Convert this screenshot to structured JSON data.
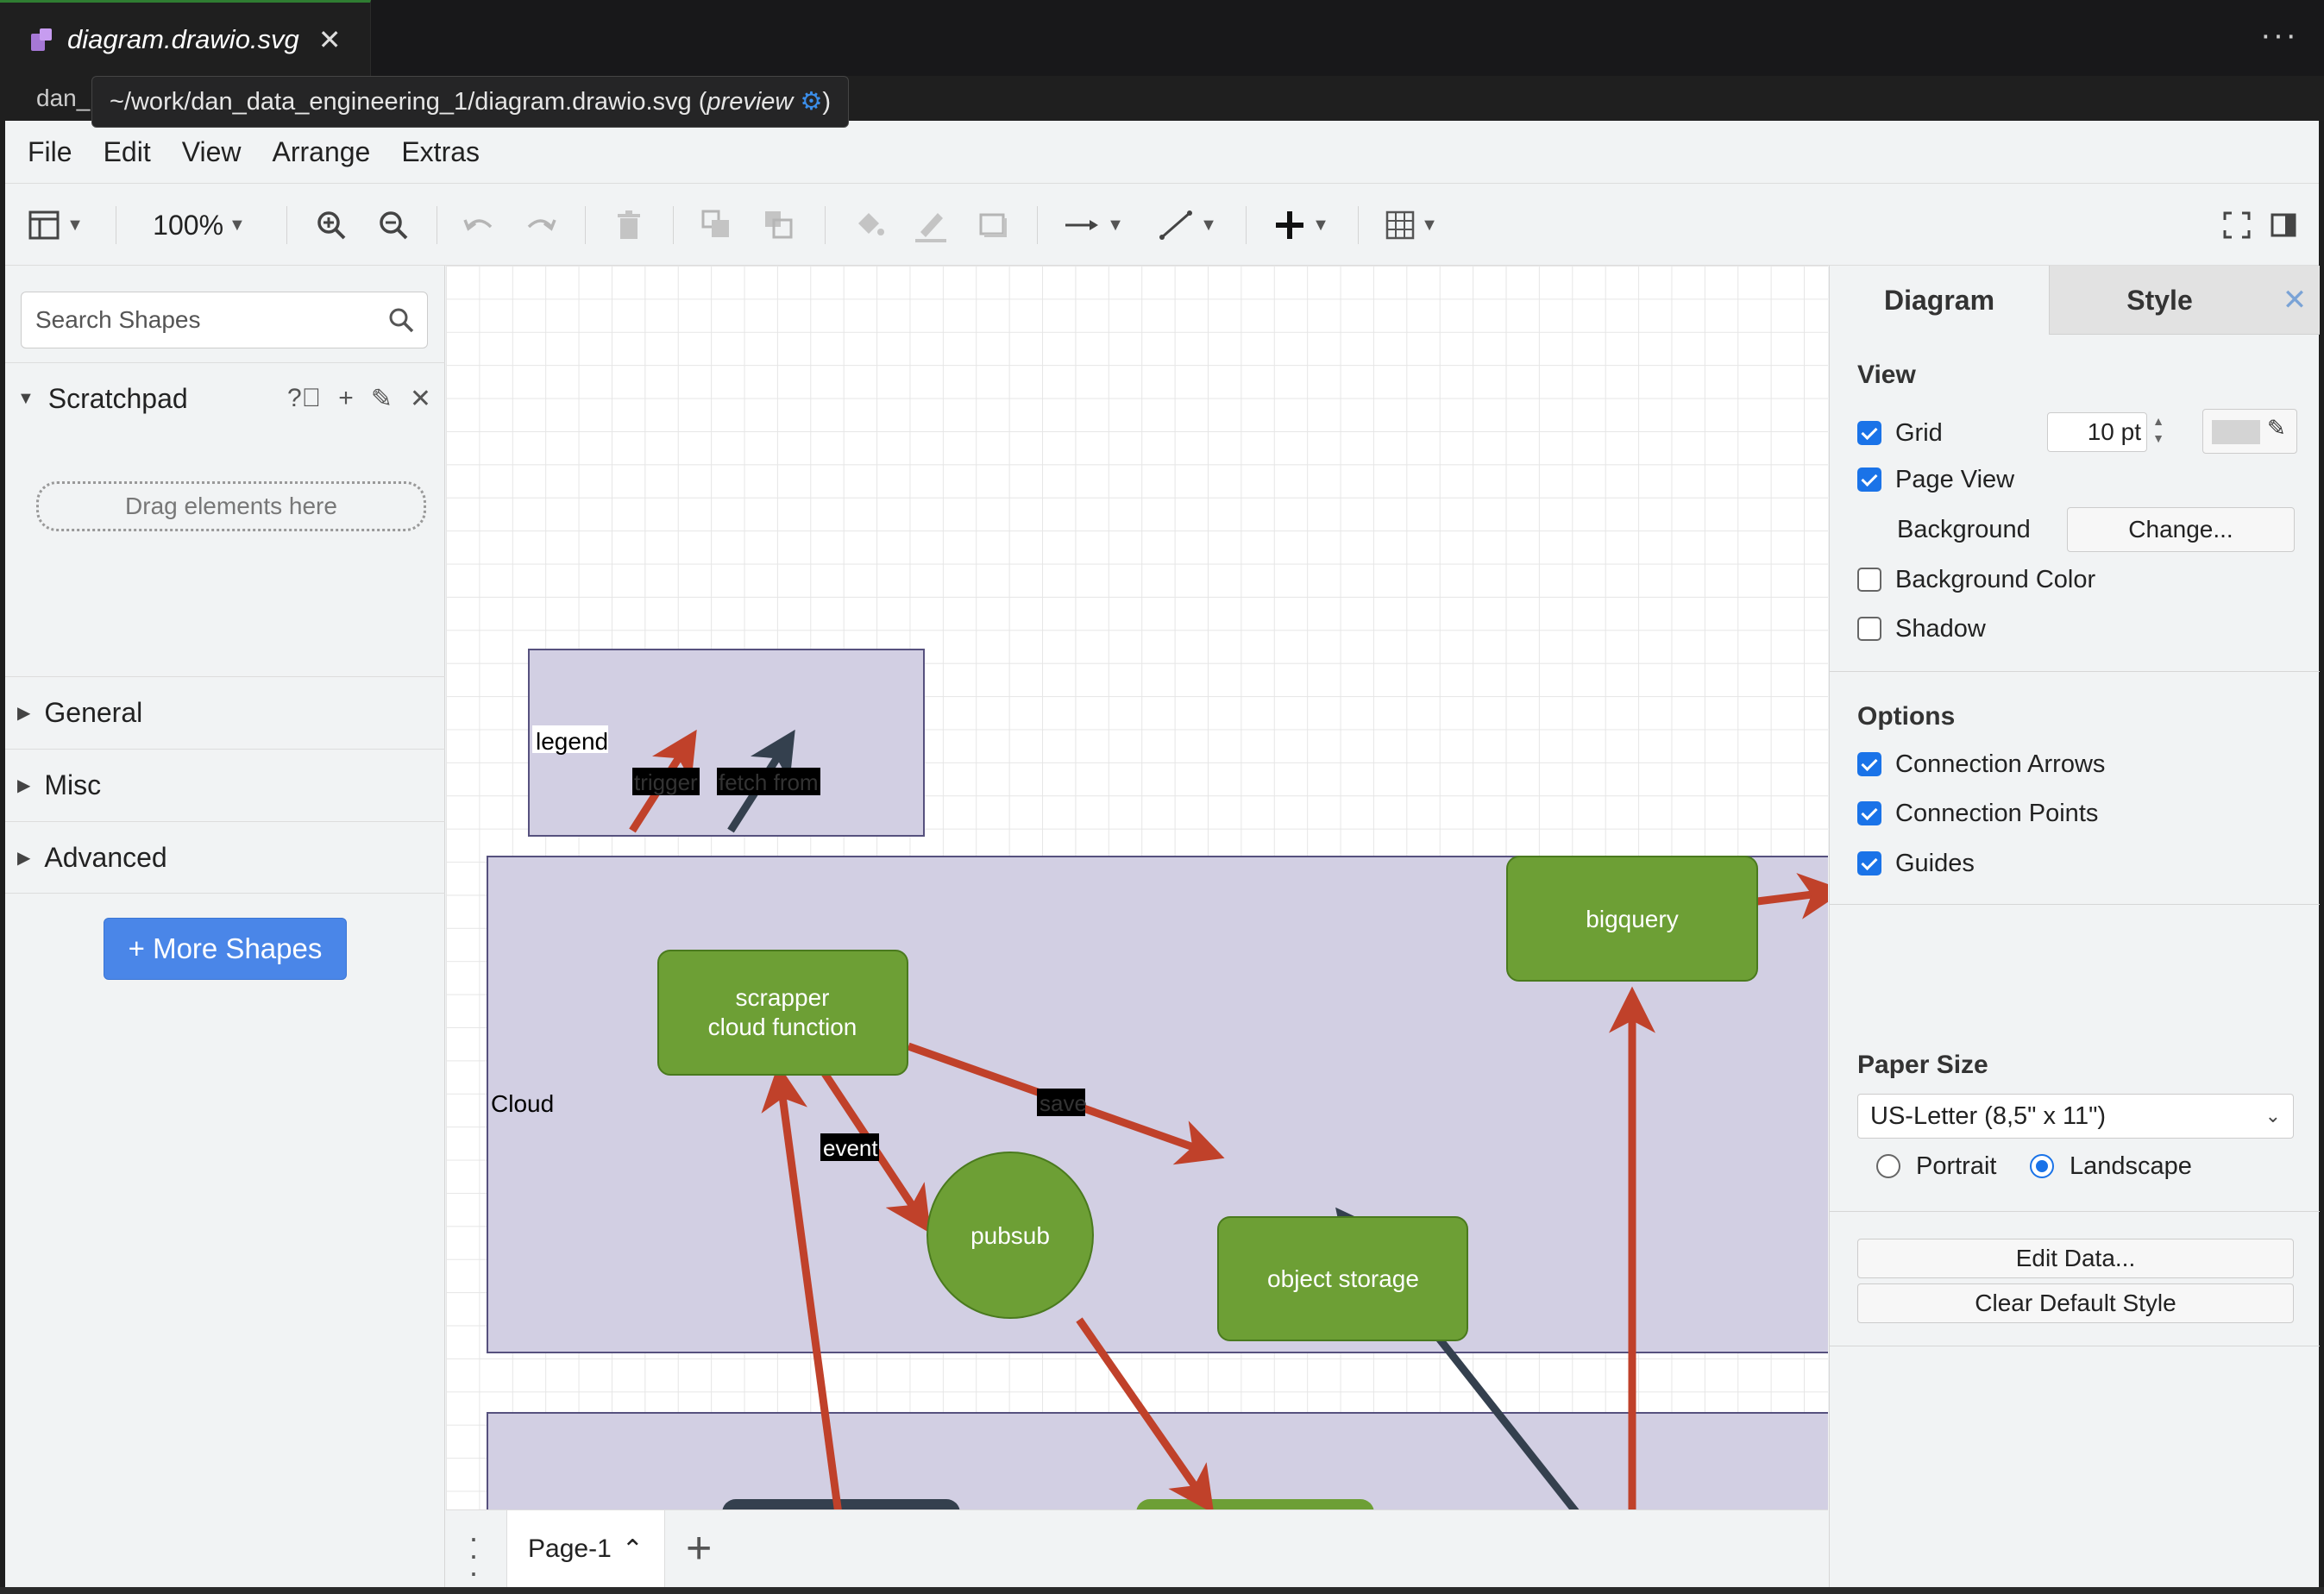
{
  "window": {
    "tab_title": "diagram.drawio.svg",
    "tab_close": "✕",
    "more_actions": "···",
    "breadcrumb_prefix": "dan_",
    "tooltip_path": "~/work/dan_data_engineering_1/diagram.drawio.svg (",
    "tooltip_preview": "preview",
    "tooltip_end": ")"
  },
  "menu": [
    "File",
    "Edit",
    "View",
    "Arrange",
    "Extras"
  ],
  "toolbar": {
    "zoom": "100%"
  },
  "sidebar": {
    "search_placeholder": "Search Shapes",
    "scratchpad_label": "Scratchpad",
    "dropzone_label": "Drag elements here",
    "sections": [
      "General",
      "Misc",
      "Advanced"
    ],
    "more_shapes_label": "More Shapes"
  },
  "diagram": {
    "legend_label": "legend",
    "legend_trigger": "trigger",
    "legend_fetch": "fetch from",
    "cloud_label": "Cloud",
    "scrapper_line1": "scrapper",
    "scrapper_line2": "cloud function",
    "object_storage": "object storage",
    "bigquery": "bigquery",
    "pubsub": "pubsub",
    "edge_save": "save",
    "edge_event": "event",
    "colors": {
      "container_fill": "#d2cfe3",
      "container_stroke": "#56517e",
      "node_fill": "#6d9f35",
      "node_stroke": "#4a7a1e",
      "trigger_arrow": "#c0412a",
      "fetch_arrow": "#34404e"
    }
  },
  "pages": {
    "current": "Page-1"
  },
  "panel": {
    "tab_diagram": "Diagram",
    "tab_style": "Style",
    "close": "✕",
    "view_heading": "View",
    "grid_label": "Grid",
    "grid_value": "10 pt",
    "page_view_label": "Page View",
    "background_label": "Background",
    "change_button": "Change...",
    "background_color_label": "Background Color",
    "shadow_label": "Shadow",
    "options_heading": "Options",
    "connection_arrows": "Connection Arrows",
    "connection_points": "Connection Points",
    "guides": "Guides",
    "paper_size_heading": "Paper Size",
    "paper_size_value": "US-Letter (8,5\" x 11\")",
    "portrait": "Portrait",
    "landscape": "Landscape",
    "edit_data": "Edit Data...",
    "clear_default_style": "Clear Default Style"
  }
}
